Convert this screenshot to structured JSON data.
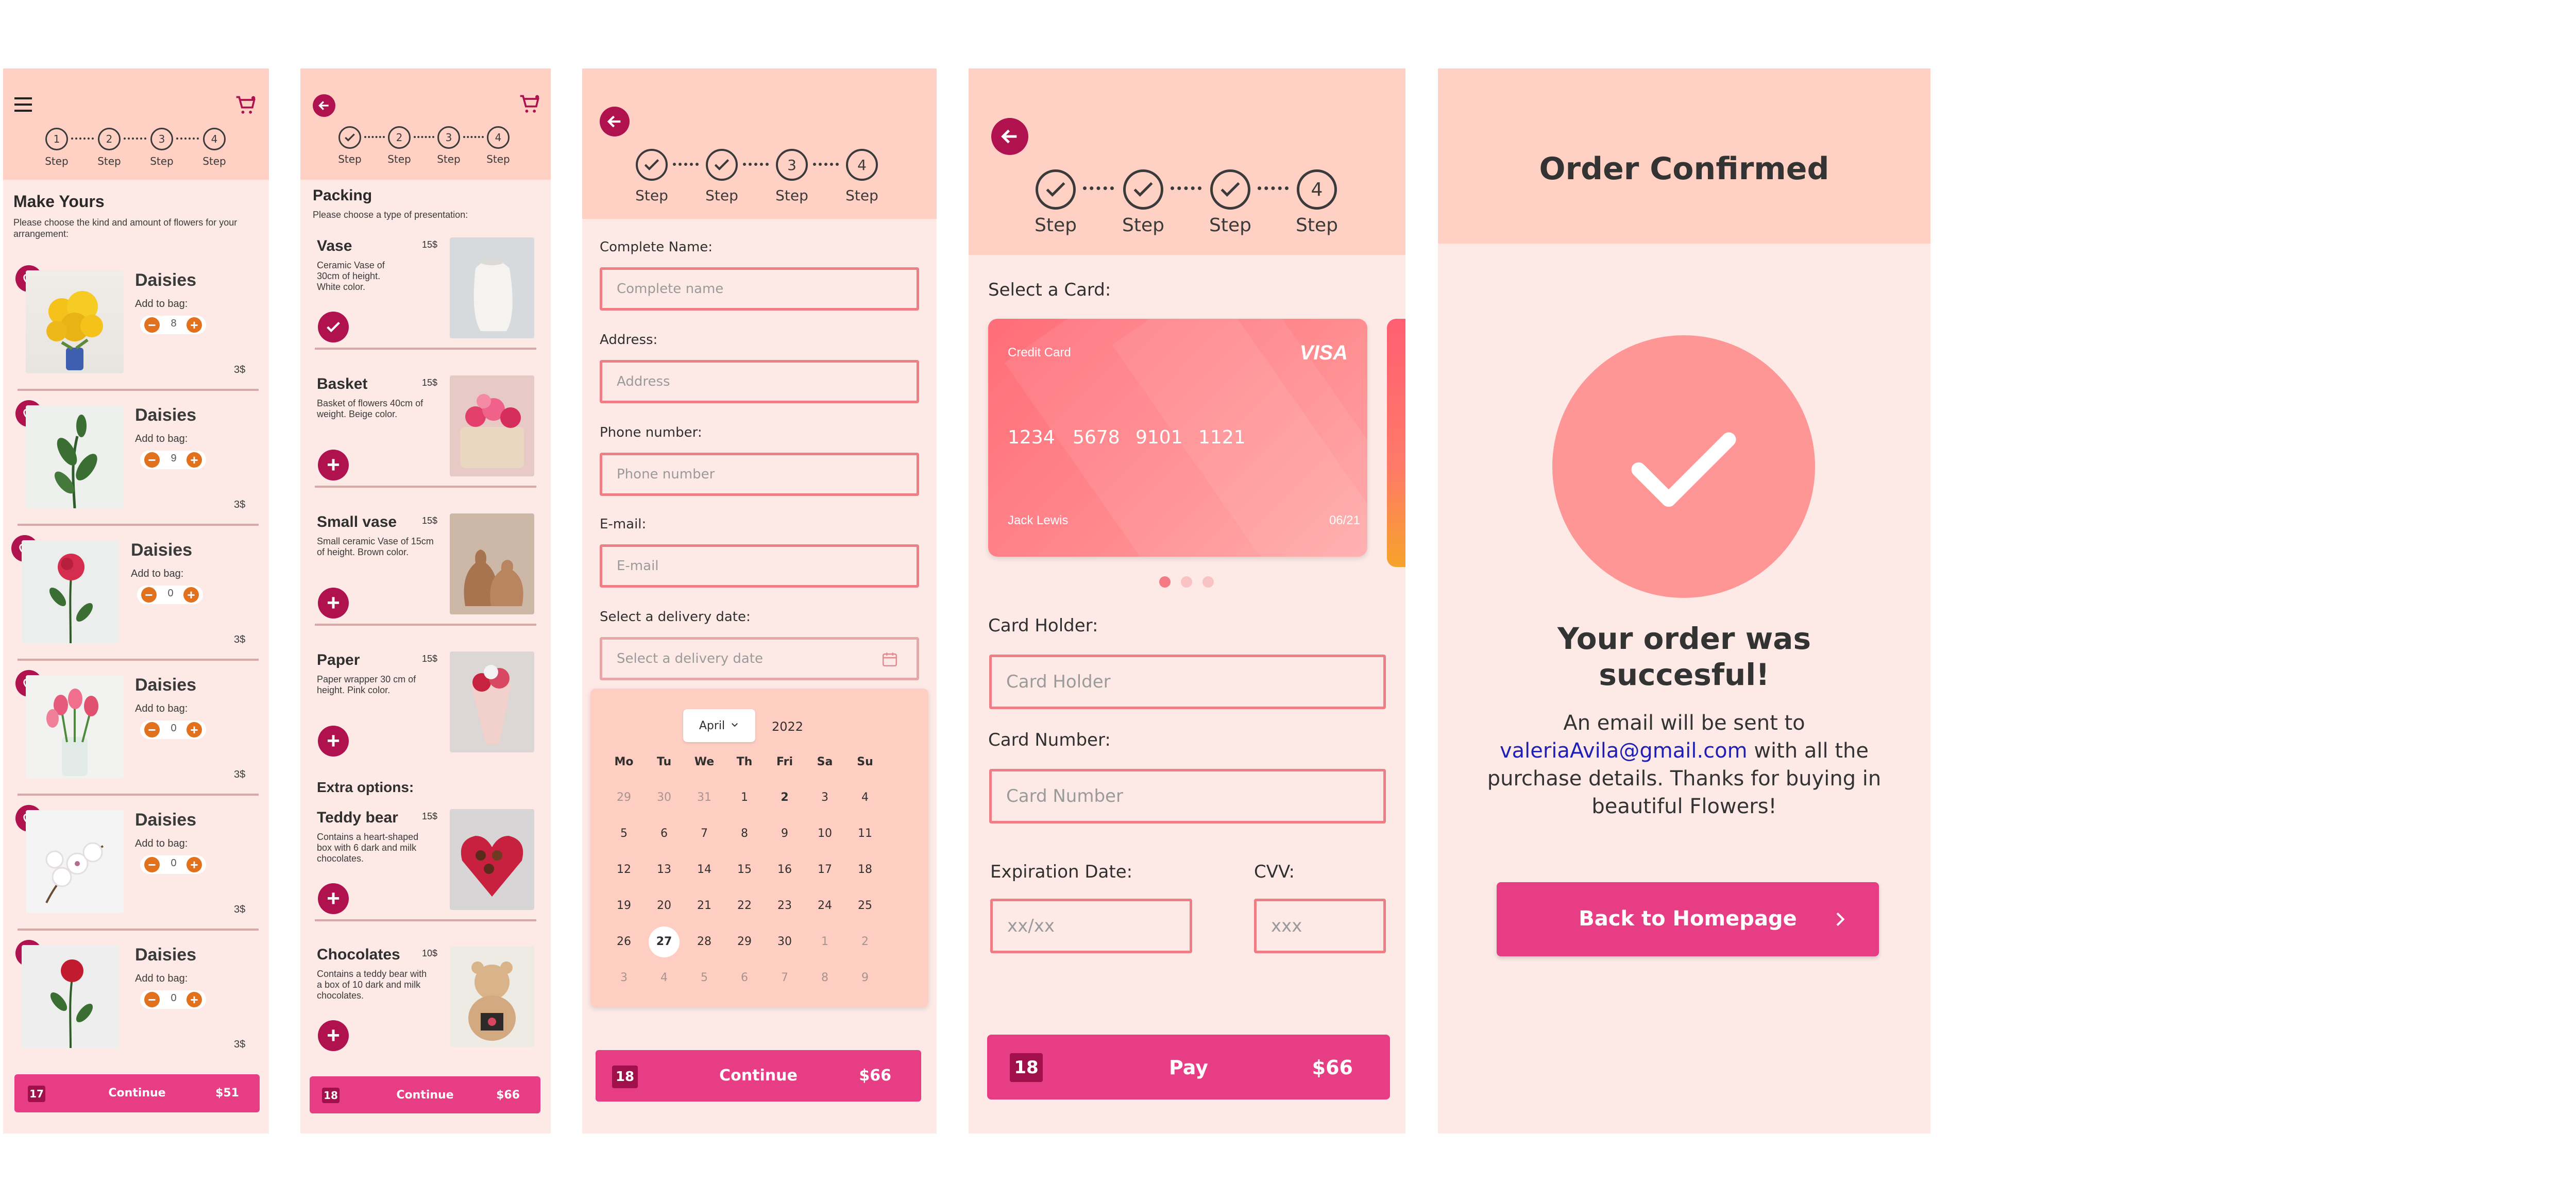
{
  "steps": {
    "labels": [
      "Step",
      "Step",
      "Step",
      "Step"
    ],
    "numbers": [
      "1",
      "2",
      "3",
      "4"
    ]
  },
  "s1": {
    "title": "Make Yours",
    "subtitle": "Please choose the kind and amount of flowers for your arrangement:",
    "items": [
      {
        "name": "Daisies",
        "add_label": "Add to bag:",
        "qty": "8",
        "price": "3$"
      },
      {
        "name": "Daisies",
        "add_label": "Add to bag:",
        "qty": "9",
        "price": "3$"
      },
      {
        "name": "Daisies",
        "add_label": "Add to bag:",
        "qty": "0",
        "price": "3$"
      },
      {
        "name": "Daisies",
        "add_label": "Add to bag:",
        "qty": "0",
        "price": "3$"
      },
      {
        "name": "Daisies",
        "add_label": "Add to bag:",
        "qty": "0",
        "price": "3$"
      },
      {
        "name": "Daisies",
        "add_label": "Add to bag:",
        "qty": "0",
        "price": "3$"
      }
    ],
    "cta": {
      "badge": "17",
      "label": "Continue",
      "total": "$51"
    }
  },
  "s2": {
    "title": "Packing",
    "subtitle": "Please choose a type of presentation:",
    "items": [
      {
        "name": "Vase",
        "price": "15$",
        "desc": "Ceramic Vase of 30cm of height. White color."
      },
      {
        "name": "Basket",
        "price": "15$",
        "desc": "Basket of flowers 40cm of weight. Beige color."
      },
      {
        "name": "Small vase",
        "price": "15$",
        "desc": "Small ceramic Vase of 15cm of height. Brown color."
      },
      {
        "name": "Paper",
        "price": "15$",
        "desc": "Paper wrapper 30 cm of height. Pink color."
      }
    ],
    "extra_title": "Extra options:",
    "extras": [
      {
        "name": "Teddy bear",
        "price": "15$",
        "desc": "Contains a heart-shaped box with 6 dark and milk chocolates."
      },
      {
        "name": "Chocolates",
        "price": "10$",
        "desc": "Contains a teddy bear with a box of 10 dark and milk chocolates."
      }
    ],
    "cta": {
      "badge": "18",
      "label": "Continue",
      "total": "$66"
    }
  },
  "s3": {
    "fields": [
      {
        "label": "Complete Name:",
        "placeholder": "Complete name"
      },
      {
        "label": "Address:",
        "placeholder": "Address"
      },
      {
        "label": "Phone number:",
        "placeholder": "Phone number"
      },
      {
        "label": "E-mail:",
        "placeholder": "E-mail"
      }
    ],
    "date_label": "Select a delivery date:",
    "date_placeholder": "Select a delivery date",
    "calendar": {
      "month": "April",
      "year": "2022",
      "weekdays": [
        "Mo",
        "Tu",
        "We",
        "Th",
        "Fri",
        "Sa",
        "Su"
      ],
      "weeks": [
        [
          "29",
          "30",
          "31",
          "1",
          "2",
          "3",
          "4"
        ],
        [
          "5",
          "6",
          "7",
          "8",
          "9",
          "10",
          "11"
        ],
        [
          "12",
          "13",
          "14",
          "15",
          "16",
          "17",
          "18"
        ],
        [
          "19",
          "20",
          "21",
          "22",
          "23",
          "24",
          "25"
        ],
        [
          "26",
          "27",
          "28",
          "29",
          "30",
          "1",
          "2"
        ],
        [
          "3",
          "4",
          "5",
          "6",
          "7",
          "8",
          "9"
        ]
      ],
      "selected": "27"
    },
    "cta": {
      "badge": "18",
      "label": "Continue",
      "total": "$66"
    }
  },
  "s4": {
    "select_label": "Select a Card:",
    "card": {
      "type": "Credit Card",
      "brand": "VISA",
      "number": [
        "1234",
        "5678",
        "9101",
        "1121"
      ],
      "holder": "Jack Lewis",
      "expiry": "06/21"
    },
    "fields": [
      {
        "label": "Card Holder:",
        "placeholder": "Card Holder"
      },
      {
        "label": "Card Number:",
        "placeholder": "Card Number"
      }
    ],
    "exp_label": "Expiration Date:",
    "exp_placeholder": "xx/xx",
    "cvv_label": "CVV:",
    "cvv_placeholder": "xxx",
    "cta": {
      "badge": "18",
      "label": "Pay",
      "total": "$66"
    }
  },
  "s5": {
    "title": "Order Confirmed",
    "headline": "Your order was succesful!",
    "msg_before": "An email will be sent to",
    "email": "valeriaAvila@gmail.com",
    "msg_after": "with all the purchase details. Thanks for buying in beautiful Flowers!",
    "button": "Back to Homepage"
  },
  "colors": {
    "header": "#ffd0c4",
    "background": "#fdeae6",
    "accent": "#e63d84",
    "dark_accent": "#b0124f",
    "orange": "#e2711d",
    "input_border": "#ee7d86"
  }
}
